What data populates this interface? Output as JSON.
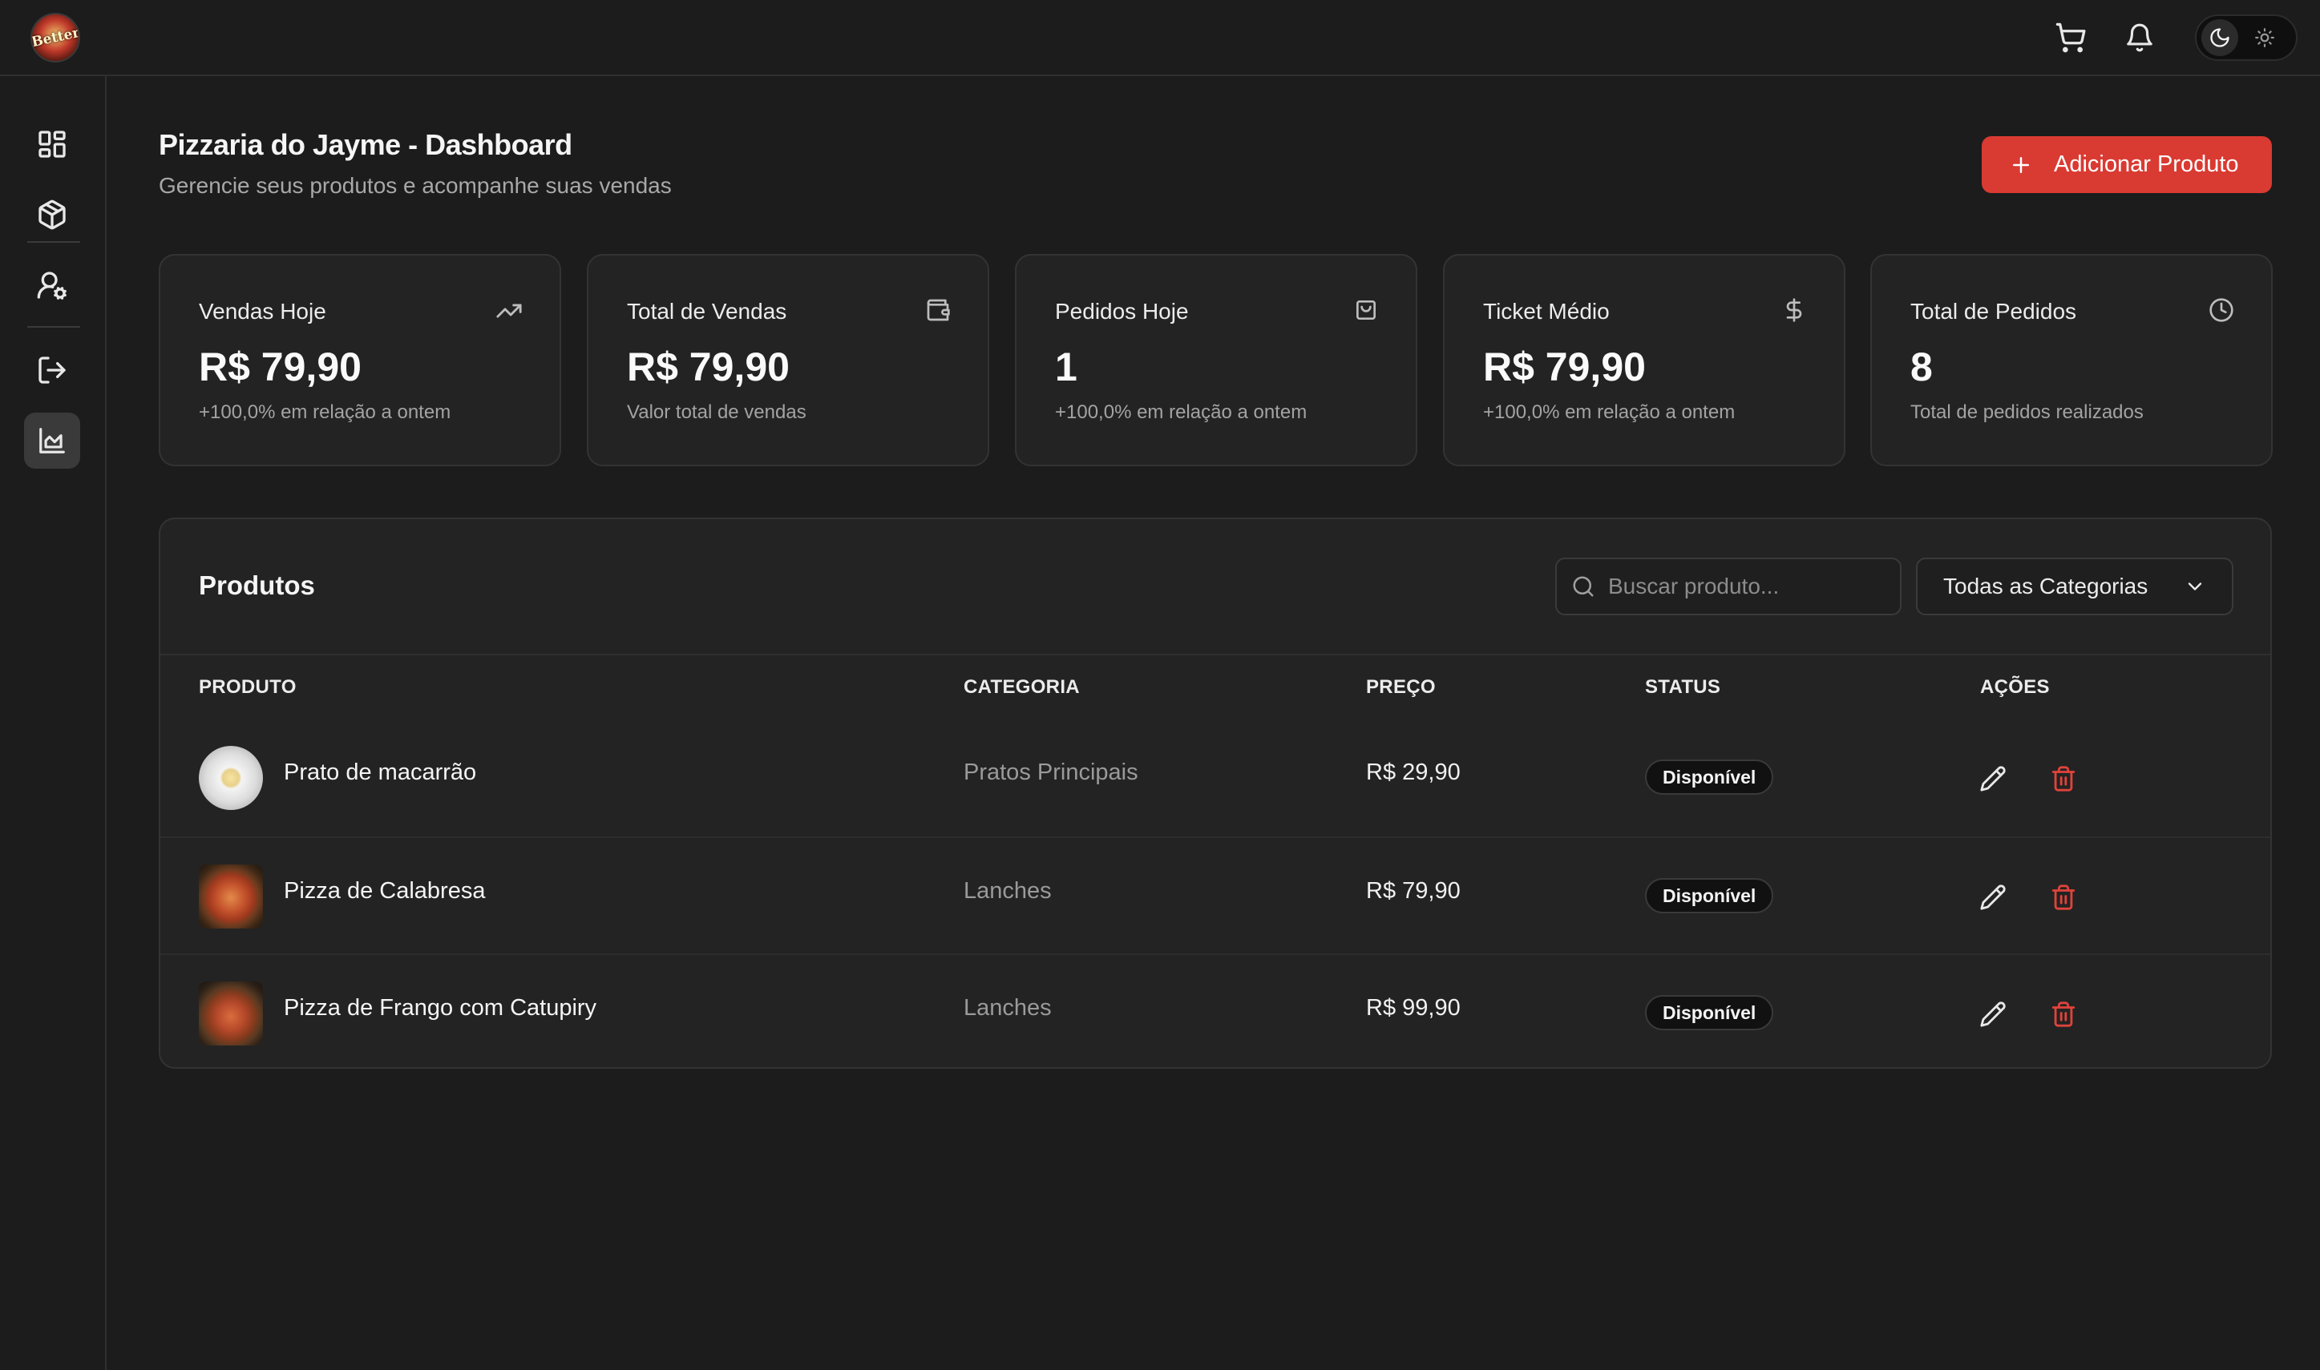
{
  "app": {
    "logo_text": "Better",
    "top_icons": [
      "cart-icon",
      "bell-icon"
    ],
    "theme": {
      "dark_icon": "moon-icon",
      "light_icon": "sun-icon",
      "selected": "dark"
    }
  },
  "sidebar": {
    "items": [
      {
        "icon": "dashboard-grid-icon",
        "active": false
      },
      {
        "icon": "package-icon",
        "active": false
      },
      {
        "icon": "user-settings-icon",
        "active": false
      },
      {
        "icon": "logout-icon",
        "active": false
      },
      {
        "icon": "area-chart-icon",
        "active": true
      }
    ],
    "footer_icon": "bolt-icon"
  },
  "header": {
    "title": "Pizzaria do Jayme - Dashboard",
    "subtitle": "Gerencie seus produtos e acompanhe suas vendas",
    "add_button_label": "Adicionar Produto"
  },
  "stats": [
    {
      "label": "Vendas Hoje",
      "value": "R$ 79,90",
      "note": "+100,0% em relação a ontem",
      "icon": "trending-up-icon"
    },
    {
      "label": "Total de Vendas",
      "value": "R$ 79,90",
      "note": "Valor total de vendas",
      "icon": "wallet-icon"
    },
    {
      "label": "Pedidos Hoje",
      "value": "1",
      "note": "+100,0% em relação a ontem",
      "icon": "shopping-bag-icon"
    },
    {
      "label": "Ticket Médio",
      "value": "R$ 79,90",
      "note": "+100,0% em relação a ontem",
      "icon": "dollar-icon"
    },
    {
      "label": "Total de Pedidos",
      "value": "8",
      "note": "Total de pedidos realizados",
      "icon": "clock-icon"
    }
  ],
  "products": {
    "title": "Produtos",
    "search_placeholder": "Buscar produto...",
    "category_filter": "Todas as Categorias",
    "columns": [
      "PRODUTO",
      "CATEGORIA",
      "PREÇO",
      "STATUS",
      "AÇÕES"
    ],
    "rows": [
      {
        "name": "Prato de macarrão",
        "category": "Pratos Principais",
        "price": "R$ 29,90",
        "status": "Disponível"
      },
      {
        "name": "Pizza de Calabresa",
        "category": "Lanches",
        "price": "R$ 79,90",
        "status": "Disponível"
      },
      {
        "name": "Pizza de Frango com Catupiry",
        "category": "Lanches",
        "price": "R$ 99,90",
        "status": "Disponível"
      }
    ]
  },
  "colors": {
    "background": "#1c1c1c",
    "card": "#232323",
    "accent": "#d93a32",
    "delete": "#e0433b"
  }
}
